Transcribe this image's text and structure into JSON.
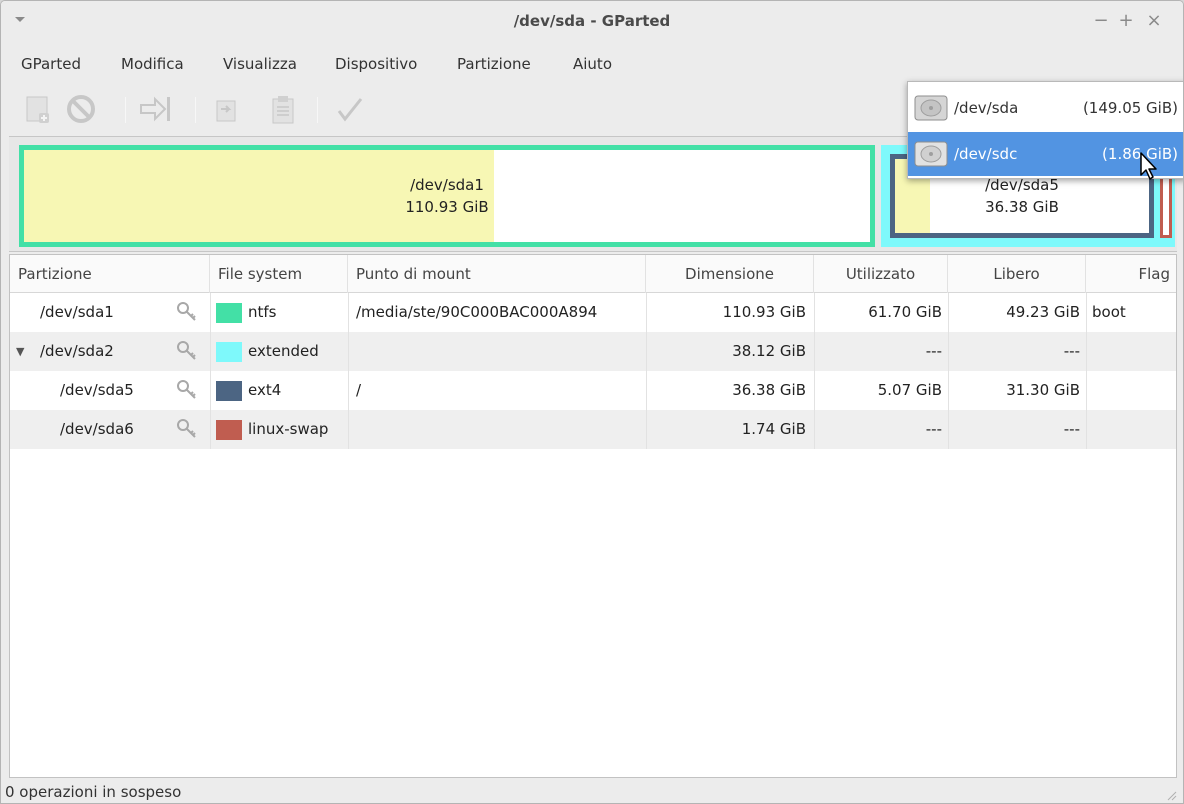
{
  "window": {
    "title": "/dev/sda - GParted",
    "controls": {
      "minimize": "−",
      "maximize": "+",
      "close": "×"
    }
  },
  "menubar": {
    "items": [
      "GParted",
      "Modifica",
      "Visualizza",
      "Dispositivo",
      "Partizione",
      "Aiuto"
    ]
  },
  "toolbar": {
    "icons": [
      "new-partition-icon",
      "delete-icon",
      "resize-move-icon",
      "copy-icon",
      "paste-icon",
      "apply-icon"
    ]
  },
  "device_popup": {
    "devices": [
      {
        "name": "/dev/sda",
        "size": "(149.05 GiB)",
        "selected": false
      },
      {
        "name": "/dev/sdc",
        "size": "(1.86 GiB)",
        "selected": true
      }
    ]
  },
  "map": {
    "sda1": {
      "name": "/dev/sda1",
      "size": "110.93 GiB",
      "used_fraction": 0.556
    },
    "sda5": {
      "name": "/dev/sda5",
      "size": "36.38 GiB",
      "used_fraction": 0.139
    },
    "colors": {
      "ntfs": "#43e0a6",
      "extended": "#7ef9fb",
      "ext4": "#4c6583",
      "linux_swap": "#c05d50",
      "used": "#f7f7b4"
    }
  },
  "table": {
    "headers": {
      "partition": "Partizione",
      "filesystem": "File system",
      "mount": "Punto di mount",
      "size": "Dimensione",
      "used": "Utilizzato",
      "free": "Libero",
      "flag": "Flag"
    },
    "rows": [
      {
        "partition": "/dev/sda1",
        "filesystem": "ntfs",
        "color": "#43e0a6",
        "mount": "/media/ste/90C000BAC000A894",
        "size": "110.93 GiB",
        "used": "61.70 GiB",
        "free": "49.23 GiB",
        "flag": "boot",
        "expander": ""
      },
      {
        "partition": "/dev/sda2",
        "filesystem": "extended",
        "color": "#7ef9fb",
        "mount": "",
        "size": "38.12 GiB",
        "used": "---",
        "free": "---",
        "flag": "",
        "expander": "▼"
      },
      {
        "partition": "/dev/sda5",
        "filesystem": "ext4",
        "color": "#4c6583",
        "mount": "/",
        "size": "36.38 GiB",
        "used": "5.07 GiB",
        "free": "31.30 GiB",
        "flag": "",
        "expander": ""
      },
      {
        "partition": "/dev/sda6",
        "filesystem": "linux-swap",
        "color": "#c05d50",
        "mount": "",
        "size": "1.74 GiB",
        "used": "---",
        "free": "---",
        "flag": "",
        "expander": ""
      }
    ]
  },
  "statusbar": {
    "text": "0 operazioni in sospeso"
  }
}
